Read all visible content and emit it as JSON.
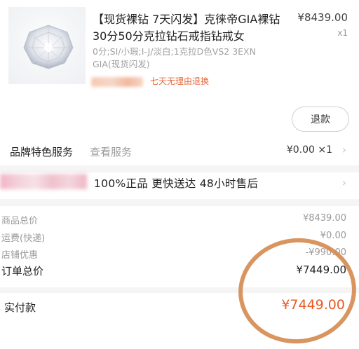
{
  "product": {
    "title": "【现货裸钻 7天闪发】克徕帝GIA裸钻30分50分克拉钻石戒指钻戒女",
    "specs": "0分;SI/小瑕;I-J/淡白;1克拉D色VS2 3EXN GIA(现货闪发)",
    "tag": "七天无理由退换",
    "price": "¥8439.00",
    "qty": "x1",
    "refund_button": "退款"
  },
  "brand_service": {
    "label": "品牌特色服务",
    "link": "查看服务",
    "price": "¥0.00 ×1"
  },
  "guarantee": "100%正品 更快送达 48小时售后",
  "summary": {
    "goods_total_label": "商品总价",
    "goods_total": "¥8439.00",
    "shipping_label": "运费(快递)",
    "shipping": "¥0.00",
    "discount_label": "店铺优惠",
    "discount": "-¥990.00",
    "order_total_label": "订单总价",
    "order_total": "¥7449.00",
    "paid_label": "实付款",
    "paid": "¥7449.00"
  },
  "colors": {
    "accent": "#e85a26",
    "circle": "#d5894f",
    "muted": "#9a9a9a"
  },
  "icons": {
    "chevron": "chevron-right-icon"
  }
}
